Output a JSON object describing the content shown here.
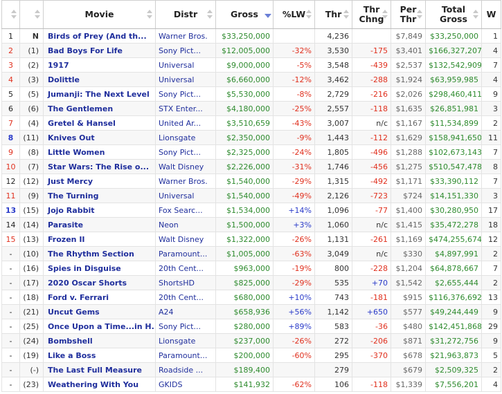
{
  "headers": {
    "rank": "",
    "prev": "",
    "movie": "Movie",
    "distr": "Distr",
    "gross": "Gross",
    "lw": "%LW",
    "thr": "Thr",
    "chng": "Thr Chng",
    "per": "Per Thr",
    "total": "Total Gross",
    "w": "W"
  },
  "colors": {
    "movie_link": "#1f2e9c",
    "gross_green": "#2e8b2e",
    "negative_red": "#e0301e",
    "positive_blue": "#2a3bc9",
    "active_sort": "#6a7fd6"
  },
  "rows": [
    {
      "rank": "1",
      "rank_color": "black",
      "prev": "N",
      "prev_bold": true,
      "movie": "Birds of Prey (And th...",
      "distr": "Warner Bros.",
      "gross": "$33,250,000",
      "lw": "",
      "lw_sign": "",
      "thr": "4,236",
      "chng": "",
      "chng_sign": "",
      "per": "$7,849",
      "total": "$33,250,000",
      "w": "1"
    },
    {
      "rank": "2",
      "rank_color": "red",
      "prev": "(1)",
      "movie": "Bad Boys For Life",
      "distr": "Sony Pict...",
      "gross": "$12,005,000",
      "lw": "-32%",
      "lw_sign": "neg",
      "thr": "3,530",
      "chng": "-175",
      "chng_sign": "neg",
      "per": "$3,401",
      "total": "$166,327,207",
      "w": "4"
    },
    {
      "rank": "3",
      "rank_color": "red",
      "prev": "(2)",
      "movie": "1917",
      "distr": "Universal",
      "gross": "$9,000,000",
      "lw": "-5%",
      "lw_sign": "neg",
      "thr": "3,548",
      "chng": "-439",
      "chng_sign": "neg",
      "per": "$2,537",
      "total": "$132,542,909",
      "w": "7"
    },
    {
      "rank": "4",
      "rank_color": "red",
      "prev": "(3)",
      "movie": "Dolittle",
      "distr": "Universal",
      "gross": "$6,660,000",
      "lw": "-12%",
      "lw_sign": "neg",
      "thr": "3,462",
      "chng": "-288",
      "chng_sign": "neg",
      "per": "$1,924",
      "total": "$63,959,985",
      "w": "4"
    },
    {
      "rank": "5",
      "rank_color": "black",
      "prev": "(5)",
      "movie": "Jumanji: The Next Level",
      "distr": "Sony Pict...",
      "gross": "$5,530,000",
      "lw": "-8%",
      "lw_sign": "neg",
      "thr": "2,729",
      "chng": "-216",
      "chng_sign": "neg",
      "per": "$2,026",
      "total": "$298,460,411",
      "w": "9"
    },
    {
      "rank": "6",
      "rank_color": "black",
      "prev": "(6)",
      "movie": "The Gentlemen",
      "distr": "STX Enter...",
      "gross": "$4,180,000",
      "lw": "-25%",
      "lw_sign": "neg",
      "thr": "2,557",
      "chng": "-118",
      "chng_sign": "neg",
      "per": "$1,635",
      "total": "$26,851,981",
      "w": "3"
    },
    {
      "rank": "7",
      "rank_color": "red",
      "prev": "(4)",
      "movie": "Gretel & Hansel",
      "distr": "United Ar...",
      "gross": "$3,510,659",
      "lw": "-43%",
      "lw_sign": "neg",
      "thr": "3,007",
      "chng": "n/c",
      "chng_sign": "na",
      "per": "$1,167",
      "total": "$11,534,899",
      "w": "2"
    },
    {
      "rank": "8",
      "rank_color": "blue",
      "prev": "(11)",
      "movie": "Knives Out",
      "distr": "Lionsgate",
      "gross": "$2,350,000",
      "lw": "-9%",
      "lw_sign": "neg",
      "thr": "1,443",
      "chng": "-112",
      "chng_sign": "neg",
      "per": "$1,629",
      "total": "$158,941,650",
      "w": "11"
    },
    {
      "rank": "9",
      "rank_color": "red",
      "prev": "(8)",
      "movie": "Little Women",
      "distr": "Sony Pict...",
      "gross": "$2,325,000",
      "lw": "-24%",
      "lw_sign": "neg",
      "thr": "1,805",
      "chng": "-496",
      "chng_sign": "neg",
      "per": "$1,288",
      "total": "$102,673,143",
      "w": "7"
    },
    {
      "rank": "10",
      "rank_color": "red",
      "prev": "(7)",
      "movie": "Star Wars: The Rise o...",
      "distr": "Walt Disney",
      "gross": "$2,226,000",
      "lw": "-31%",
      "lw_sign": "neg",
      "thr": "1,746",
      "chng": "-456",
      "chng_sign": "neg",
      "per": "$1,275",
      "total": "$510,547,478",
      "w": "8"
    },
    {
      "rank": "12",
      "rank_color": "black",
      "prev": "(12)",
      "movie": "Just Mercy",
      "distr": "Warner Bros.",
      "gross": "$1,540,000",
      "lw": "-29%",
      "lw_sign": "neg",
      "thr": "1,315",
      "chng": "-492",
      "chng_sign": "neg",
      "per": "$1,171",
      "total": "$33,390,112",
      "w": "7"
    },
    {
      "rank": "11",
      "rank_color": "red",
      "prev": "(9)",
      "movie": "The Turning",
      "distr": "Universal",
      "gross": "$1,540,000",
      "lw": "-49%",
      "lw_sign": "neg",
      "thr": "2,126",
      "chng": "-723",
      "chng_sign": "neg",
      "per": "$724",
      "total": "$14,151,330",
      "w": "3"
    },
    {
      "rank": "13",
      "rank_color": "blue",
      "prev": "(15)",
      "movie": "Jojo Rabbit",
      "distr": "Fox Searc...",
      "gross": "$1,534,000",
      "lw": "+14%",
      "lw_sign": "pos",
      "thr": "1,096",
      "chng": "-77",
      "chng_sign": "neg",
      "per": "$1,400",
      "total": "$30,280,950",
      "w": "17"
    },
    {
      "rank": "14",
      "rank_color": "black",
      "prev": "(14)",
      "movie": "Parasite",
      "distr": "Neon",
      "gross": "$1,500,000",
      "lw": "+3%",
      "lw_sign": "pos",
      "thr": "1,060",
      "chng": "n/c",
      "chng_sign": "na",
      "per": "$1,415",
      "total": "$35,472,278",
      "w": "18"
    },
    {
      "rank": "15",
      "rank_color": "red",
      "prev": "(13)",
      "movie": "Frozen II",
      "distr": "Walt Disney",
      "gross": "$1,322,000",
      "lw": "-26%",
      "lw_sign": "neg",
      "thr": "1,131",
      "chng": "-261",
      "chng_sign": "neg",
      "per": "$1,169",
      "total": "$474,255,674",
      "w": "12"
    },
    {
      "rank": "-",
      "rank_color": "black",
      "prev": "(10)",
      "movie": "The Rhythm Section",
      "distr": "Paramount...",
      "gross": "$1,005,000",
      "lw": "-63%",
      "lw_sign": "neg",
      "thr": "3,049",
      "chng": "n/c",
      "chng_sign": "na",
      "per": "$330",
      "total": "$4,897,991",
      "w": "2"
    },
    {
      "rank": "-",
      "rank_color": "black",
      "prev": "(16)",
      "movie": "Spies in Disguise",
      "distr": "20th Cent...",
      "gross": "$963,000",
      "lw": "-19%",
      "lw_sign": "neg",
      "thr": "800",
      "chng": "-228",
      "chng_sign": "neg",
      "per": "$1,204",
      "total": "$64,878,667",
      "w": "7"
    },
    {
      "rank": "-",
      "rank_color": "black",
      "prev": "(17)",
      "movie": "2020 Oscar Shorts",
      "distr": "ShortsHD",
      "gross": "$825,000",
      "lw": "-29%",
      "lw_sign": "neg",
      "thr": "535",
      "chng": "+70",
      "chng_sign": "pos",
      "per": "$1,542",
      "total": "$2,655,444",
      "w": "2"
    },
    {
      "rank": "-",
      "rank_color": "black",
      "prev": "(18)",
      "movie": "Ford v. Ferrari",
      "distr": "20th Cent...",
      "gross": "$680,000",
      "lw": "+10%",
      "lw_sign": "pos",
      "thr": "743",
      "chng": "-181",
      "chng_sign": "neg",
      "per": "$915",
      "total": "$116,376,692",
      "w": "13"
    },
    {
      "rank": "-",
      "rank_color": "black",
      "prev": "(21)",
      "movie": "Uncut Gems",
      "distr": "A24",
      "gross": "$658,936",
      "lw": "+56%",
      "lw_sign": "pos",
      "thr": "1,142",
      "chng": "+650",
      "chng_sign": "pos",
      "per": "$577",
      "total": "$49,244,449",
      "w": "9"
    },
    {
      "rank": "-",
      "rank_color": "black",
      "prev": "(25)",
      "movie": "Once Upon a Time...in H...",
      "distr": "Sony Pict...",
      "gross": "$280,000",
      "lw": "+89%",
      "lw_sign": "pos",
      "thr": "583",
      "chng": "-36",
      "chng_sign": "neg",
      "per": "$480",
      "total": "$142,451,868",
      "w": "29"
    },
    {
      "rank": "-",
      "rank_color": "black",
      "prev": "(24)",
      "movie": "Bombshell",
      "distr": "Lionsgate",
      "gross": "$237,000",
      "lw": "-26%",
      "lw_sign": "neg",
      "thr": "272",
      "chng": "-206",
      "chng_sign": "neg",
      "per": "$871",
      "total": "$31,272,756",
      "w": "9"
    },
    {
      "rank": "-",
      "rank_color": "black",
      "prev": "(19)",
      "movie": "Like a Boss",
      "distr": "Paramount...",
      "gross": "$200,000",
      "lw": "-60%",
      "lw_sign": "neg",
      "thr": "295",
      "chng": "-370",
      "chng_sign": "neg",
      "per": "$678",
      "total": "$21,963,873",
      "w": "5"
    },
    {
      "rank": "-",
      "rank_color": "black",
      "prev": "(-)",
      "movie": "The Last Full Measure",
      "distr": "Roadside ...",
      "gross": "$189,400",
      "lw": "",
      "lw_sign": "",
      "thr": "279",
      "chng": "",
      "chng_sign": "",
      "per": "$679",
      "total": "$2,509,325",
      "w": "2"
    },
    {
      "rank": "-",
      "rank_color": "black",
      "prev": "(23)",
      "movie": "Weathering With You",
      "distr": "GKIDS",
      "gross": "$141,932",
      "lw": "-62%",
      "lw_sign": "neg",
      "thr": "106",
      "chng": "-118",
      "chng_sign": "neg",
      "per": "$1,339",
      "total": "$7,556,201",
      "w": "4"
    }
  ]
}
